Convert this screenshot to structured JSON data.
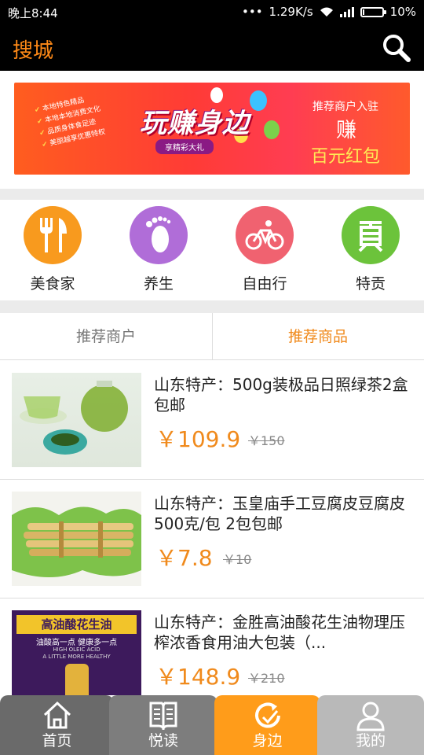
{
  "status": {
    "time": "晚上8:44",
    "speed": "1.29K/s",
    "battery": "10%",
    "battery_level": 0.1
  },
  "header": {
    "title": "搜城",
    "search_icon": "search-icon"
  },
  "banner": {
    "main_text": "玩赚身边",
    "ribbon_text": "享精彩大礼",
    "left_list": [
      "本地特色精品",
      "本地本地消费文化",
      "品质身体食足迹",
      "美丽越享优惠特权"
    ],
    "cta_line1": "推荐商户入驻",
    "cta_line2": "赚",
    "cta_line3": "百元红包"
  },
  "categories": [
    {
      "label": "美食家",
      "icon": "fork-knife-icon",
      "color": "#f89a1e"
    },
    {
      "label": "养生",
      "icon": "footprint-icon",
      "color": "#b06dd8"
    },
    {
      "label": "自由行",
      "icon": "bicycle-icon",
      "color": "#f06270"
    },
    {
      "label": "特贡",
      "icon": "gong-icon",
      "color": "#6cc33b"
    }
  ],
  "tabs": [
    {
      "label": "推荐商户",
      "active": false
    },
    {
      "label": "推荐商品",
      "active": true
    }
  ],
  "products": [
    {
      "title": "山东特产：500g装极品日照绿茶2盒包邮",
      "price": "￥109.9",
      "old_price": "￥150"
    },
    {
      "title": "山东特产：玉皇庙手工豆腐皮豆腐皮500克/包 2包包邮",
      "price": "￥7.8",
      "old_price": "￥10"
    },
    {
      "title": "山东特产：金胜高油酸花生油物理压榨浓香食用油大包装（...",
      "price": "￥148.9",
      "old_price": "￥210",
      "image_text": {
        "line1": "高油酸花生油",
        "line2": "油酸高一点 健康多一点",
        "line3": "HIGH OLEIC ACID",
        "line4": "A LITTLE MORE HEALTHY"
      }
    }
  ],
  "nav": [
    {
      "label": "首页",
      "icon": "home-icon"
    },
    {
      "label": "悦读",
      "icon": "book-icon"
    },
    {
      "label": "身边",
      "icon": "nearby-icon",
      "active": true
    },
    {
      "label": "我的",
      "icon": "user-icon"
    }
  ],
  "colors": {
    "accent": "#ff8a17",
    "price": "#f08a1c",
    "nav_active": "#ff9c1a",
    "nav_dark": "#6a6a6a",
    "nav_mid": "#7d7d7d",
    "nav_light": "#b9b9b9"
  }
}
